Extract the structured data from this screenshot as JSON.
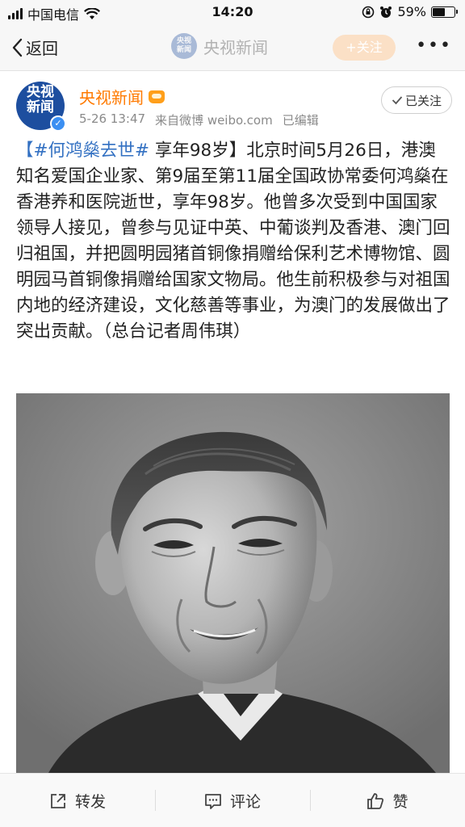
{
  "status_bar": {
    "carrier": "中国电信",
    "time": "14:20",
    "battery": "59%",
    "battery_level": 0.59
  },
  "nav": {
    "back_label": "返回",
    "title": "央视新闻",
    "follow_label": "+关注",
    "more_label": "•••"
  },
  "author": {
    "name": "央视新闻",
    "avatar_text_top": "央视",
    "avatar_text_bottom": "新闻",
    "date": "5-26 13:47",
    "source": "来自微博 weibo.com",
    "edited": "已编辑",
    "followed_label": "已关注"
  },
  "post": {
    "hashtag": "【#何鸿燊去世#",
    "body": " 享年98岁】北京时间5月26日，港澳知名爱国企业家、第9届至第11届全国政协常委何鸿燊在香港养和医院逝世，享年98岁。他曾多次受到中国国家领导人接见，曾参与见证中英、中葡谈判及香港、澳门回归祖国，并把圆明园猪首铜像捐赠给保利艺术博物馆、圆明园马首铜像捐赠给国家文物局。他生前积极参与对祖国内地的经济建设，文化慈善等事业，为澳门的发展做出了突出贡献。（总台记者周伟琪）"
  },
  "actions": {
    "repost_label": "转发",
    "comment_label": "评论",
    "like_label": "赞"
  },
  "colors": {
    "accent_orange": "#ff7a00",
    "hashtag_blue": "#3270c2"
  }
}
